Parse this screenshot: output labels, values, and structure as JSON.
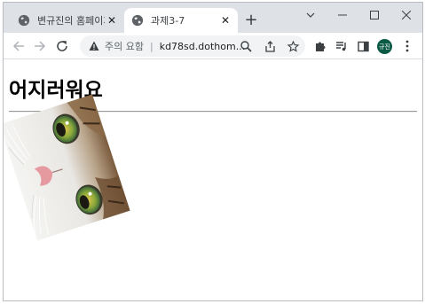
{
  "browser": {
    "tabs": [
      {
        "title": "변규진의 홈페이지",
        "active": false
      },
      {
        "title": "과제3-7",
        "active": true
      }
    ],
    "tab_close_glyph": "✕",
    "new_tab_glyph": "+",
    "window_controls": [
      "chevron-down-icon",
      "minimize-icon",
      "maximize-icon",
      "close-icon"
    ],
    "security_label": "주의 요함",
    "url": "kd78sd.dothom...",
    "profile_initials": "규진",
    "profile_color": "#0b5a45"
  },
  "page": {
    "heading": "어지러워요",
    "image": {
      "subject": "cat",
      "rotation_deg": -18
    }
  }
}
